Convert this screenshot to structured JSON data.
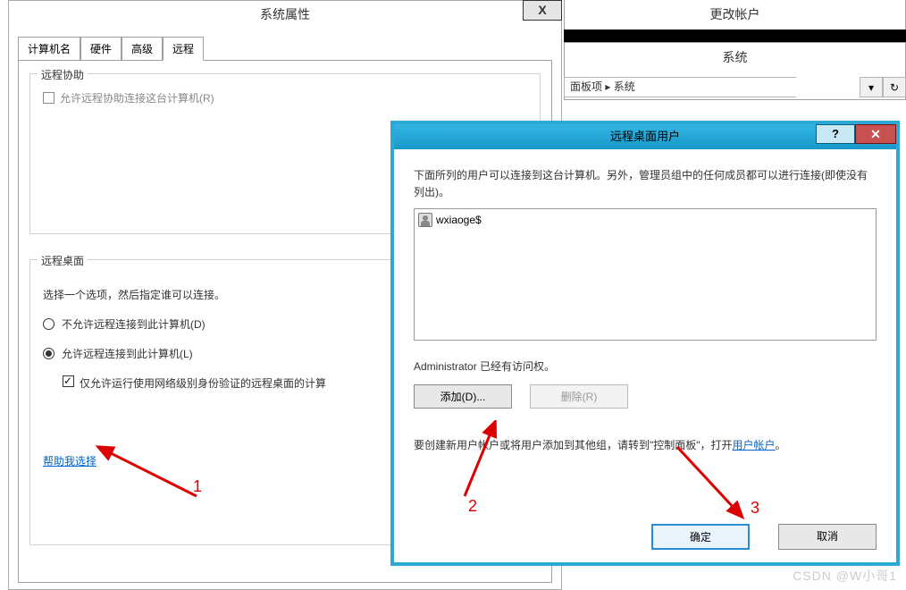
{
  "bg": {
    "change_account": "更改帐户",
    "system": "系统",
    "breadcrumb": "面板项 ▸ 系统"
  },
  "sysprop": {
    "title": "系统属性",
    "close_x": "X",
    "tabs": {
      "computer_name": "计算机名",
      "hardware": "硬件",
      "advanced": "高级",
      "remote": "远程"
    },
    "remote_assist": {
      "legend": "远程协助",
      "allow_label": "允许远程协助连接这台计算机(R)"
    },
    "remote_desktop": {
      "legend": "远程桌面",
      "choose_hint": "选择一个选项，然后指定谁可以连接。",
      "opt_deny": "不允许远程连接到此计算机(D)",
      "opt_allow": "允许远程连接到此计算机(L)",
      "chk_nla": "仅允许运行使用网络级别身份验证的远程桌面的计算",
      "help_link": "帮助我选择"
    }
  },
  "rdu": {
    "title": "远程桌面用户",
    "help_q": "?",
    "close_x": "✕",
    "desc": "下面所列的用户可以连接到这台计算机。另外，管理员组中的任何成员都可以进行连接(即使没有列出)。",
    "user_entry": "wxiaoge$",
    "admin_note": "Administrator 已经有访问权。",
    "btn_add": "添加(D)...",
    "btn_remove": "删除(R)",
    "footnote_pre": "要创建新用户帐户或将用户添加到其他组，请转到\"控制面板\"，打开",
    "footnote_link": "用户帐户",
    "footnote_post": "。",
    "btn_ok": "确定",
    "btn_cancel": "取消"
  },
  "annotations": {
    "n1": "1",
    "n2": "2",
    "n3": "3"
  },
  "watermark": "CSDN @W小哥1"
}
